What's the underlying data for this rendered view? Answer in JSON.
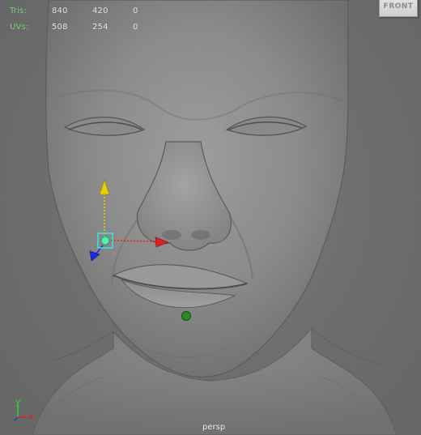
{
  "viewport": {
    "camera": "persp",
    "viewcube_face": "FRONT"
  },
  "hud": {
    "rows": [
      {
        "label": "Tris:",
        "values": [
          "840",
          "420",
          "0"
        ]
      },
      {
        "label": "UVs:",
        "values": [
          "508",
          "254",
          "0"
        ]
      }
    ]
  },
  "axes": {
    "y_label": "y",
    "x_label": "x"
  },
  "colors": {
    "hud_label": "#7fd67f",
    "hud_value": "#e6e6e6",
    "background": "#6f6f6f",
    "gizmo_y": "#e5d000",
    "gizmo_x": "#e02020",
    "gizmo_z": "#1f2ae0",
    "gizmo_center": "#3fe0e0",
    "joint_locator": "#2a8a2a"
  },
  "icons": {
    "move_manipulator": "move-manipulator-icon",
    "view_axis": "view-axis-triad-icon",
    "viewcube": "viewcube-icon"
  }
}
